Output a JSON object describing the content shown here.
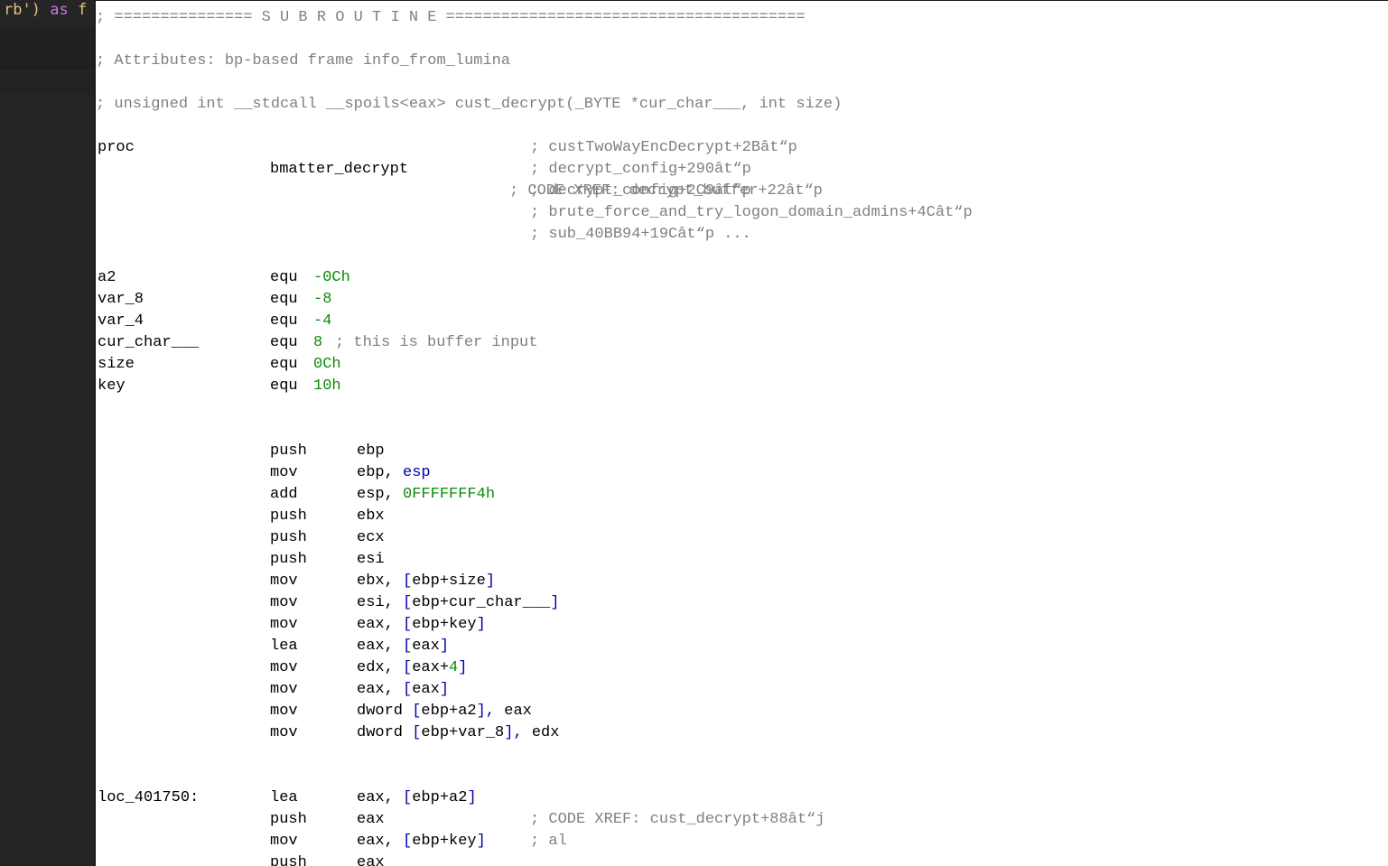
{
  "editor_snippet": {
    "text_str": "rb')",
    "keyword": "as",
    "trail": "f"
  },
  "header": {
    "separator": "; =============== S U B R O U T I N E =======================================",
    "attributes": "; Attributes: bp-based frame info_from_lumina",
    "signature": "; unsigned int __stdcall __spoils<eax> cust_decrypt(_BYTE *cur_char___, int size)"
  },
  "proc": {
    "keyword": "proc",
    "name": "bmatter_decrypt",
    "xrefs": [
      "; CODE XREF: decrypt_buffer+22ât“p",
      "; custTwoWayEncDecrypt+2Bât“p",
      "; decrypt_config+290ât“p",
      "; decrypt_config+2C9ât“p",
      "; brute_force_and_try_logon_domain_admins+4Cât“p",
      "; sub_40BB94+19Cât“p ..."
    ]
  },
  "locals": [
    {
      "name": "a2",
      "op": "equ",
      "value": "-0Ch",
      "comment": ""
    },
    {
      "name": "var_8",
      "op": "equ",
      "value": "-8",
      "comment": ""
    },
    {
      "name": "var_4",
      "op": "equ",
      "value": "-4",
      "comment": ""
    },
    {
      "name": "cur_char___",
      "op": "equ",
      "value": "8",
      "comment": "; this is buffer input"
    },
    {
      "name": "size",
      "op": "equ",
      "value": "0Ch",
      "comment": ""
    },
    {
      "name": "key",
      "op": "equ",
      "value": "10h",
      "comment": ""
    }
  ],
  "instructions": [
    {
      "mn": "push",
      "a1": "ebp",
      "sep": "",
      "pre": "",
      "inner": "",
      "num": "",
      "post": "",
      "cmt": ""
    },
    {
      "mn": "mov",
      "a1": "ebp,",
      "sep": " ",
      "pre": "esp",
      "inner": "",
      "num": "",
      "post": "",
      "cmt": ""
    },
    {
      "mn": "add",
      "a1": "esp,",
      "sep": " ",
      "pre": "",
      "inner": "",
      "num": "0FFFFFFF4h",
      "post": "",
      "cmt": ""
    },
    {
      "mn": "push",
      "a1": "ebx",
      "sep": "",
      "pre": "",
      "inner": "",
      "num": "",
      "post": "",
      "cmt": ""
    },
    {
      "mn": "push",
      "a1": "ecx",
      "sep": "",
      "pre": "",
      "inner": "",
      "num": "",
      "post": "",
      "cmt": ""
    },
    {
      "mn": "push",
      "a1": "esi",
      "sep": "",
      "pre": "",
      "inner": "",
      "num": "",
      "post": "",
      "cmt": ""
    },
    {
      "mn": "mov",
      "a1": "ebx,",
      "sep": " ",
      "pre": "[",
      "inner": "ebp+size",
      "num": "",
      "post": "]",
      "cmt": ""
    },
    {
      "mn": "mov",
      "a1": "esi,",
      "sep": " ",
      "pre": "[",
      "inner": "ebp+cur_char___",
      "num": "",
      "post": "]",
      "cmt": ""
    },
    {
      "mn": "mov",
      "a1": "eax,",
      "sep": " ",
      "pre": "[",
      "inner": "ebp+key",
      "num": "",
      "post": "]",
      "cmt": ""
    },
    {
      "mn": "lea",
      "a1": "eax,",
      "sep": " ",
      "pre": "[",
      "inner": "eax",
      "num": "",
      "post": "]",
      "cmt": ""
    },
    {
      "mn": "mov",
      "a1": "edx,",
      "sep": " ",
      "pre": "[",
      "inner": "eax+",
      "num": "4",
      "post": "]",
      "cmt": ""
    },
    {
      "mn": "mov",
      "a1": "eax,",
      "sep": " ",
      "pre": "[",
      "inner": "eax",
      "num": "",
      "post": "]",
      "cmt": ""
    },
    {
      "mn": "mov",
      "a1": "dword",
      "sep": " ",
      "pre": "[",
      "inner": "ebp+a2",
      "num": "",
      "post": "], eax",
      "cmt": ""
    },
    {
      "mn": "mov",
      "a1": "dword",
      "sep": " ",
      "pre": "[",
      "inner": "ebp+var_8",
      "num": "",
      "post": "], edx",
      "cmt": ""
    }
  ],
  "loc": {
    "label": "loc_401750:",
    "xref": "; CODE XREF: cust_decrypt+88ât“j"
  },
  "loc_instructions": [
    {
      "mn": "lea",
      "a1": "eax,",
      "sep": " ",
      "pre": "[",
      "inner": "ebp+a2",
      "num": "",
      "post": "]",
      "cmt": ""
    },
    {
      "mn": "push",
      "a1": "eax",
      "sep": "",
      "pre": "",
      "inner": "",
      "num": "",
      "post": "",
      "cmt": ""
    },
    {
      "mn": "mov",
      "a1": "eax,",
      "sep": " ",
      "pre": "[",
      "inner": "ebp+key",
      "num": "",
      "post": "]",
      "cmt": "; al"
    },
    {
      "mn": "push",
      "a1": "eax",
      "sep": "",
      "pre": "",
      "inner": "",
      "num": "",
      "post": "",
      "cmt": ""
    }
  ]
}
